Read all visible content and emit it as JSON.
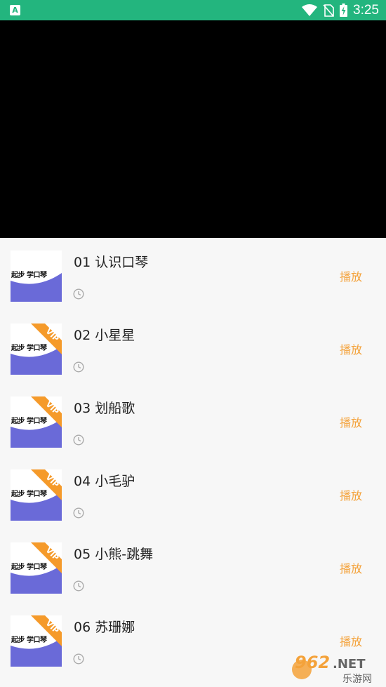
{
  "status_bar": {
    "app_icon_letter": "A",
    "time": "3:25",
    "background": "#23b57e",
    "icons": [
      "wifi-icon",
      "no-sim-icon",
      "battery-charging-icon"
    ]
  },
  "video_player": {
    "background": "#000000"
  },
  "thumbnail": {
    "title": "起步 学口琴",
    "vip_label": "VIP"
  },
  "songs": [
    {
      "title": "01 认识口琴",
      "vip": false,
      "action": "播放"
    },
    {
      "title": "02 小星星",
      "vip": true,
      "action": "播放"
    },
    {
      "title": "03 划船歌",
      "vip": true,
      "action": "播放"
    },
    {
      "title": "04 小毛驴",
      "vip": true,
      "action": "播放"
    },
    {
      "title": "05 小熊-跳舞",
      "vip": true,
      "action": "播放"
    },
    {
      "title": "06 苏珊娜",
      "vip": true,
      "action": "播放"
    }
  ],
  "colors": {
    "accent": "#f4a23a",
    "thumb_purple": "#6a6ad8",
    "vip_orange": "#f59a2a"
  },
  "watermark": {
    "number": "962",
    "suffix": ".NET",
    "text": "乐游网"
  }
}
